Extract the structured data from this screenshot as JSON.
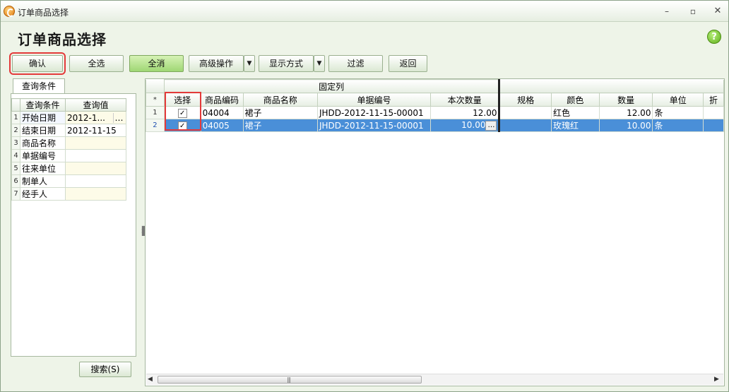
{
  "window": {
    "title": "订单商品选择",
    "minimize": "–",
    "maximize": "▫",
    "close": "✕"
  },
  "header": {
    "title": "订单商品选择",
    "help": "?"
  },
  "toolbar": {
    "confirm": "确认",
    "select_all": "全选",
    "clear_all": "全消",
    "advanced": "高级操作",
    "display_mode": "显示方式",
    "filter": "过滤",
    "back": "返回",
    "dropdown_arrow": "▼"
  },
  "query": {
    "tab": "查询条件",
    "col_condition": "查询条件",
    "col_value": "查询值",
    "rows": [
      {
        "idx": "1",
        "name": "开始日期",
        "value": "2012-1..."
      },
      {
        "idx": "2",
        "name": "结束日期",
        "value": "2012-11-15"
      },
      {
        "idx": "3",
        "name": "商品名称",
        "value": ""
      },
      {
        "idx": "4",
        "name": "单据编号",
        "value": ""
      },
      {
        "idx": "5",
        "name": "往来单位",
        "value": ""
      },
      {
        "idx": "6",
        "name": "制单人",
        "value": ""
      },
      {
        "idx": "7",
        "name": "经手人",
        "value": ""
      }
    ],
    "ellipsis": "…",
    "search_button": "搜索(S)"
  },
  "grid": {
    "band": "固定列",
    "row_marker": "*",
    "columns": [
      "选择",
      "商品编码",
      "商品名称",
      "单据编号",
      "本次数量",
      "规格",
      "颜色",
      "数量",
      "单位",
      "折"
    ],
    "rows": [
      {
        "idx": "1",
        "code": "04004",
        "name": "裙子",
        "doc_no": "JHDD-2012-11-15-00001",
        "qty_now": "12.00",
        "spec": "",
        "color": "红色",
        "qty": "12.00",
        "unit": "条",
        "checked": "✓"
      },
      {
        "idx": "2",
        "code": "04005",
        "name": "裙子",
        "doc_no": "JHDD-2012-11-15-00001",
        "qty_now": "10.00",
        "spec": "",
        "color": "玫瑰红",
        "qty": "10.00",
        "unit": "条",
        "checked": "✓"
      }
    ],
    "cell_ellipsis": "…"
  },
  "scrollbar": {
    "left_arrow": "◀",
    "right_arrow": "▶",
    "grip": "|||"
  }
}
